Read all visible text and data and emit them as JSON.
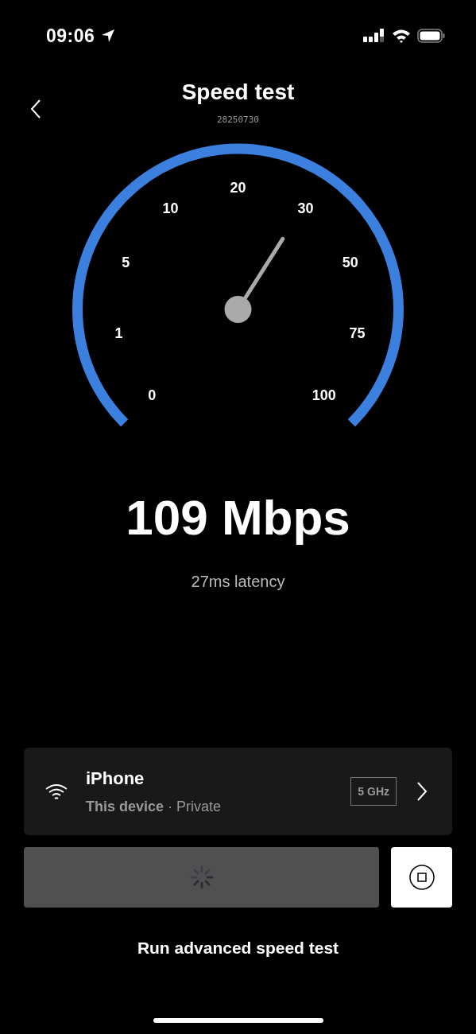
{
  "status_bar": {
    "time": "09:06"
  },
  "header": {
    "title": "Speed test",
    "subtitle": "28250730"
  },
  "gauge": {
    "labels": [
      "0",
      "1",
      "5",
      "10",
      "20",
      "30",
      "50",
      "75",
      "100"
    ]
  },
  "result": {
    "speed": "109 Mbps",
    "latency": "27ms latency"
  },
  "network": {
    "name": "iPhone",
    "detail": "**This device** · Private",
    "band": "5 GHz"
  },
  "link": "Run advanced speed test"
}
